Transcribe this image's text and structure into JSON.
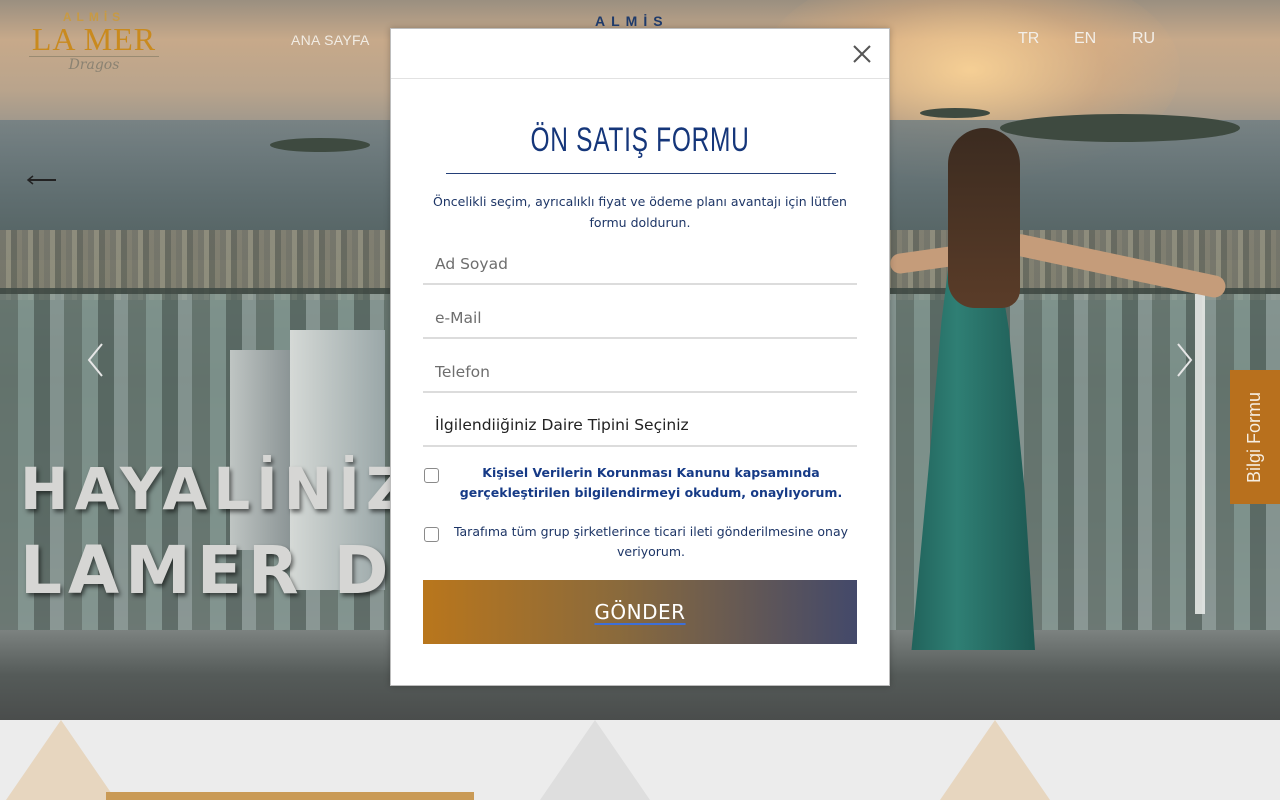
{
  "header": {
    "logo": {
      "top": "ALMİS",
      "middle": "LA MER",
      "bottom": "Dragos"
    },
    "nav": {
      "home_label": "ANA SAYFA",
      "partial_label": ""
    },
    "languages": [
      "TR",
      "EN",
      "RU"
    ]
  },
  "hero": {
    "headline_line1": "HAYALİNİZİ",
    "headline_line2": "LAMER D"
  },
  "side_tab": {
    "label": "Bilgi Formu"
  },
  "modal": {
    "brand": "ALMİS",
    "title": "ÖN SATIŞ FORMU",
    "subtitle": "Öncelikli seçim, ayrıcalıklı fiyat ve ödeme planı avantajı için lütfen formu doldurun.",
    "fields": {
      "name_placeholder": "Ad Soyad",
      "email_placeholder": "e-Mail",
      "phone_placeholder": "Telefon",
      "apartment_select": "İlgilendiiğiniz Daire Tipini Seçiniz"
    },
    "consent_kvkk": "Kişisel Verilerin Korunması Kanunu kapsamında gerçekleştirilen bilgilendirmeyi okudum, onaylıyorum.",
    "consent_marketing": "Tarafıma tüm grup şirketlerince ticari ileti gönderilmesine onay veriyorum.",
    "submit_label": "GÖNDER"
  },
  "colors": {
    "brand_navy": "#15367a",
    "brand_gold": "#b8701d",
    "button_gradient_start": "#b9761c",
    "button_gradient_end": "#43496a"
  },
  "icons": [
    "close-icon",
    "chevron-left-icon",
    "chevron-right-icon",
    "arrow-left-icon"
  ]
}
